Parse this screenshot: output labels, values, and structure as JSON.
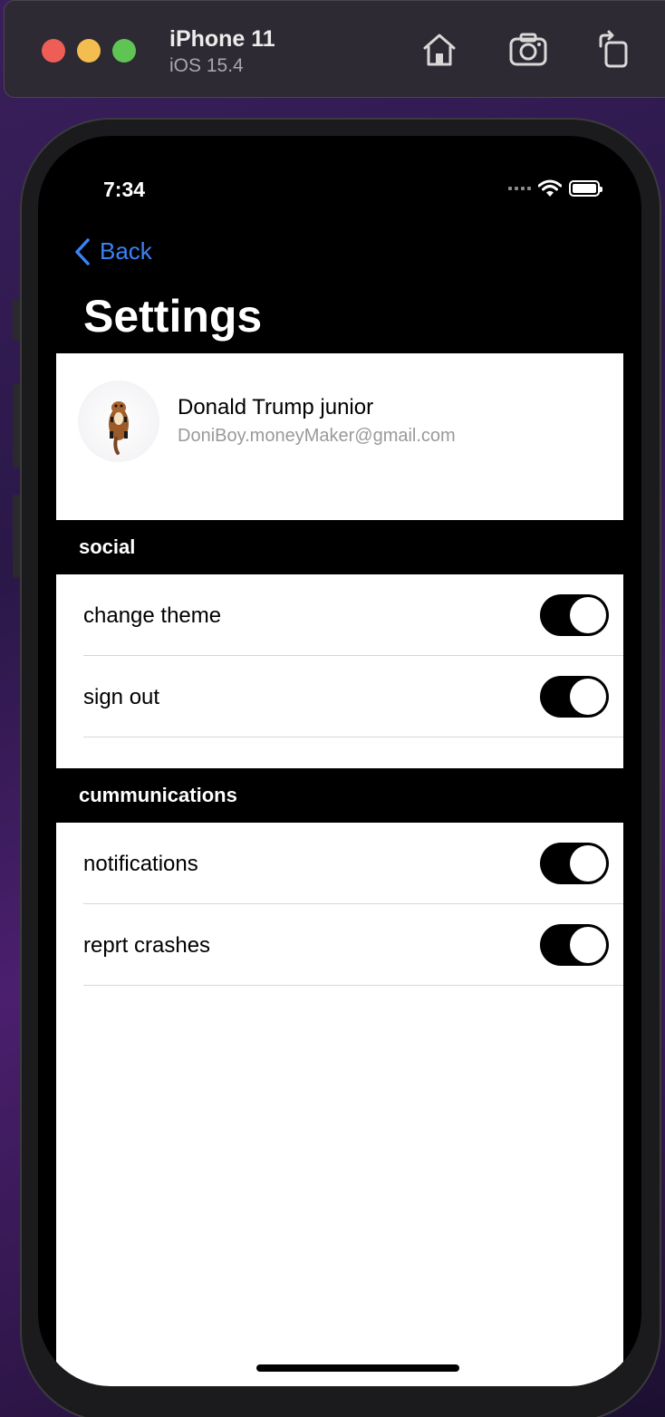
{
  "simulator": {
    "device_name": "iPhone 11",
    "os_version": "iOS 15.4",
    "toolbar_icons": [
      "home-icon",
      "screenshot-icon",
      "rotate-icon"
    ]
  },
  "status_bar": {
    "time": "7:34",
    "icons": [
      "cellular-signal-icon",
      "wifi-icon",
      "battery-icon"
    ]
  },
  "nav": {
    "back_label": "Back",
    "title": "Settings"
  },
  "profile": {
    "name": "Donald Trump junior",
    "email": "DoniBoy.moneyMaker@gmail.com"
  },
  "sections": [
    {
      "header": "social",
      "rows": [
        {
          "label": "change theme",
          "toggle_on": true
        },
        {
          "label": "sign out",
          "toggle_on": true
        }
      ]
    },
    {
      "header": "cummunications",
      "rows": [
        {
          "label": "notifications",
          "toggle_on": true
        },
        {
          "label": "reprt crashes",
          "toggle_on": true
        }
      ]
    }
  ],
  "colors": {
    "accent": "#3b82f6",
    "toggle_track": "#000000",
    "toggle_knob": "#ffffff"
  }
}
